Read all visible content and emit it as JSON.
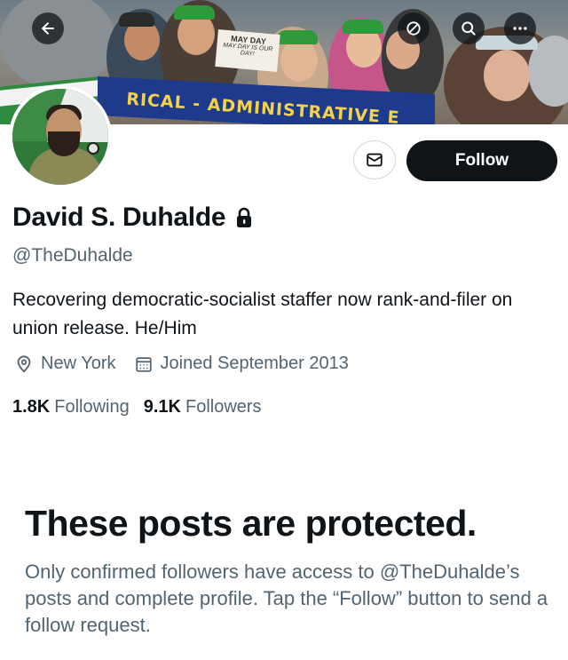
{
  "banner": {
    "back_icon": "arrow-left-icon",
    "mute_icon": "circle-slash-icon",
    "search_icon": "search-icon",
    "more_icon": "more-horizontal-icon",
    "sign_text": "MAY DAY",
    "sign_subtext": "MAY DAY IS OUR DAY!",
    "banner_text": "RICAL - ADMINISTRATIVE E"
  },
  "actions": {
    "message_icon": "envelope-icon",
    "follow_label": "Follow"
  },
  "profile": {
    "name": "David S. Duhalde",
    "lock_icon": "lock-icon",
    "handle": "@TheDuhalde",
    "bio": "Recovering democratic-socialist staffer now rank-and-filer on union release. He/Him",
    "location_icon": "location-pin-icon",
    "location": "New York",
    "joined_icon": "calendar-icon",
    "joined": "Joined September 2013",
    "following_count": "1.8K",
    "following_label": "Following",
    "followers_count": "9.1K",
    "followers_label": "Followers"
  },
  "protected": {
    "title": "These posts are protected.",
    "description": "Only confirmed followers have access to @TheDuhalde’s posts and complete profile. Tap the “Follow” button to send a follow request."
  },
  "colors": {
    "primary_text": "#0f1419",
    "secondary_text": "#536471",
    "follow_button": "#0f1419",
    "border": "#cfd9de"
  }
}
